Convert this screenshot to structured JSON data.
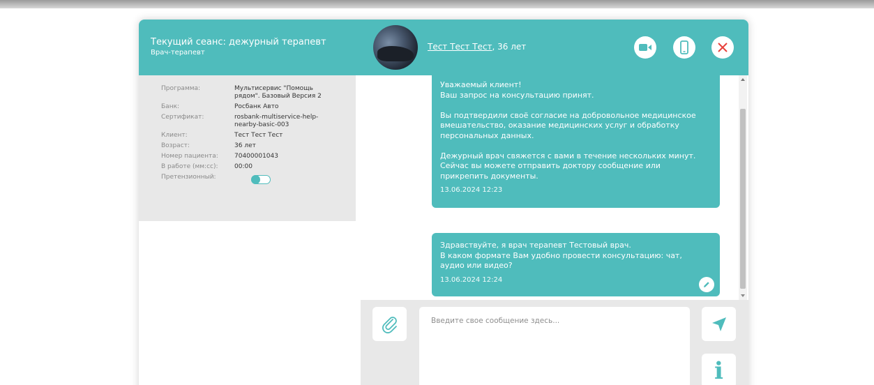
{
  "colors": {
    "accent": "#4fbcbc",
    "close": "#e8413c",
    "panel": "#e8e8e8"
  },
  "header": {
    "session_title": "Текущий сеанс: дежурный терапевт",
    "session_subtitle": "Врач-терапевт",
    "patient_name": "Тест Тест Тест",
    "patient_age": ", 36 лет",
    "buttons": {
      "video": "video-camera-icon",
      "phone": "phone-icon",
      "close": "close-icon"
    }
  },
  "info": {
    "rows": [
      {
        "label": "Программа:",
        "value": "Мультисервис \"Помощь рядом\". Базовый Версия 2"
      },
      {
        "label": "Банк:",
        "value": "Росбанк Авто"
      },
      {
        "label": "Сертификат:",
        "value": "rosbank-multiservice-help-nearby-basic-003"
      },
      {
        "label": "Клиент:",
        "value": "Тест Тест Тест"
      },
      {
        "label": "Возраст:",
        "value": "36 лет"
      },
      {
        "label": "Номер пациента:",
        "value": "70400001043"
      },
      {
        "label": "В работе (мм:сс):",
        "value": "00:00"
      }
    ],
    "claim_label": "Претензионный:"
  },
  "messages": [
    {
      "lines": [
        "Уважаемый клиент!",
        "Ваш запрос на консультацию принят.",
        "Вы подтвердили своё согласие на добровольное медицинское",
        "вмешательство, оказание медицинских услуг и обработку",
        "персональных данных.",
        "Дежурный врач свяжется с вами в течение нескольких минут.",
        "Сейчас вы можете отправить доктору сообщение или",
        "прикрепить документы."
      ],
      "time": "13.06.2024 12:23"
    },
    {
      "lines": [
        "Здравствуйте, я врач терапевт Тестовый врач.",
        "В каком формате Вам удобно провести консультацию: чат,",
        "аудио или видео?"
      ],
      "time": "13.06.2024 12:24"
    }
  ],
  "composer": {
    "placeholder": "Введите свое сообщение здесь...",
    "attach_icon": "paperclip-icon",
    "send_icon": "send-icon",
    "info_icon": "info-icon",
    "info_glyph": "i"
  }
}
